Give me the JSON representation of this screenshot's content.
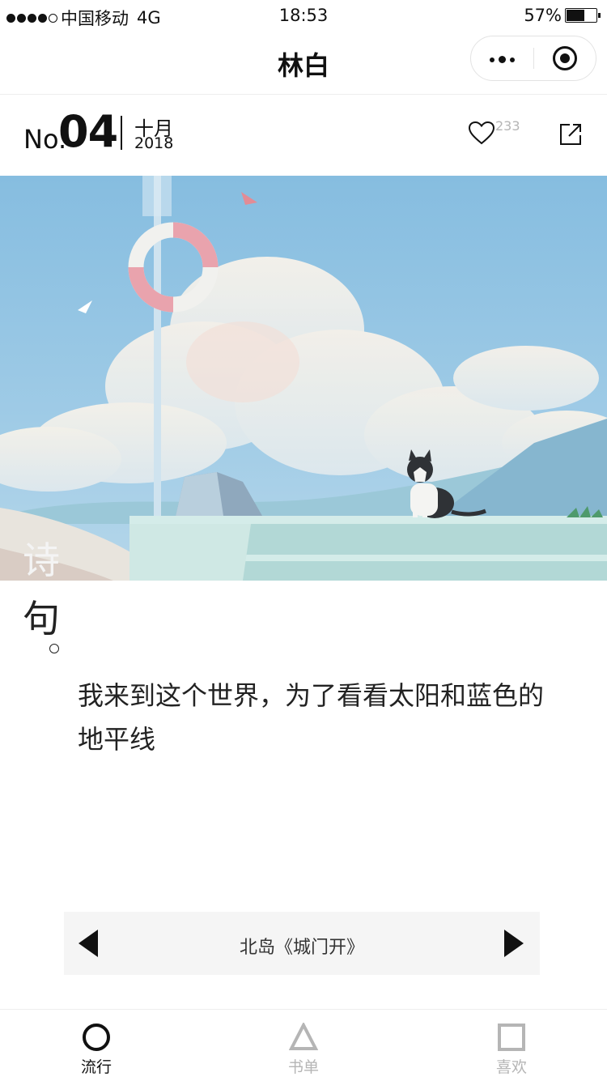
{
  "status_bar": {
    "carrier": "中国移动",
    "network": "4G",
    "time": "18:53",
    "battery": "57%",
    "battery_level": 0.57
  },
  "nav": {
    "title": "林白",
    "capsule_icons": [
      "more-icon",
      "target-icon"
    ]
  },
  "header": {
    "no_prefix": "No.",
    "number": "04",
    "month": "十月",
    "year": "2018",
    "like_count": "233"
  },
  "hero": {
    "description_icon": "illustration",
    "colors": {
      "sky": "#8cc1e0",
      "cloud": "#f3efe6",
      "ring_red": "#e9a3ad",
      "ledge": "#b2d8d6"
    }
  },
  "type_label": {
    "char1": "诗",
    "char2": "句",
    "mark": "。"
  },
  "content": {
    "quote": "我来到这个世界，为了看看太阳和蓝色的地平线"
  },
  "author_bar": {
    "author": "北岛《城门开》"
  },
  "tabs": [
    {
      "label": "流行",
      "icon": "circle-icon",
      "active": true
    },
    {
      "label": "书单",
      "icon": "triangle-icon",
      "active": false
    },
    {
      "label": "喜欢",
      "icon": "square-icon",
      "active": false
    }
  ]
}
